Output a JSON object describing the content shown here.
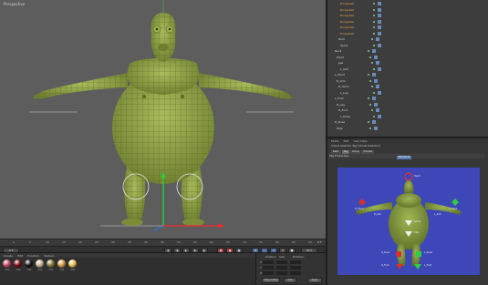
{
  "viewport": {
    "label": "Perspective",
    "header_icons": [
      "move-icon",
      "zoom-icon",
      "rotate-icon",
      "maximize-icon"
    ],
    "footer_text": "Grid Spacing: 100 cm"
  },
  "timeline": {
    "ticks": [
      "0",
      "5",
      "10",
      "15",
      "20",
      "25",
      "30",
      "35",
      "40",
      "45",
      "50",
      "55",
      "60",
      "65",
      "70",
      "75",
      "80",
      "85",
      "90"
    ],
    "current_frame": "0 F"
  },
  "transport": {
    "start_field": "0 F",
    "end_field": "90 F"
  },
  "materials": {
    "menu": [
      "Create",
      "Edit",
      "Function",
      "Texture"
    ],
    "items": [
      {
        "name": "Mat",
        "color": "#c84a6a"
      },
      {
        "name": "Mat",
        "color": "#7a1010"
      },
      {
        "name": "Mat",
        "color": "#1a1a1a"
      },
      {
        "name": "Mat",
        "color": "#c9b592"
      },
      {
        "name": "Mat",
        "color": "#8c7a3c"
      },
      {
        "name": "Mat",
        "color": "#d7a14a"
      },
      {
        "name": "Mat",
        "color": "#e8c25a"
      }
    ]
  },
  "coordinates": {
    "headers": [
      "Position",
      "Size",
      "Rotation"
    ],
    "rows": [
      {
        "axis": "X",
        "pos": "0 cm",
        "size": "0 cm",
        "rot": "H 0°"
      },
      {
        "axis": "Y",
        "pos": "0 cm",
        "size": "0 cm",
        "rot": "P 0°"
      },
      {
        "axis": "Z",
        "pos": "0 cm",
        "size": "0 cm",
        "rot": "B 0°"
      }
    ],
    "mode_select": "Object (Rel)",
    "size_select": "Size",
    "apply_button": "Apply"
  },
  "object_manager": {
    "menu": [
      "File",
      "Edit",
      "View",
      "Objects",
      "Tags",
      "Bookmarks"
    ],
    "rows": [
      {
        "name": "Bridgeball",
        "highlight": true
      },
      {
        "name": "Bridgeball",
        "highlight": true
      },
      {
        "name": "Bridgeball",
        "highlight": true
      },
      {
        "name": "Bridgeball",
        "highlight": true
      },
      {
        "name": "Bridgeball",
        "highlight": true
      },
      {
        "name": "Bridgeball",
        "highlight": true
      },
      {
        "name": "Root",
        "highlight": false
      },
      {
        "name": "Spine",
        "highlight": false
      },
      {
        "name": "Neck",
        "highlight": false
      },
      {
        "name": "Head",
        "highlight": false
      },
      {
        "name": "Jaw",
        "highlight": false
      },
      {
        "name": "L_Arm",
        "highlight": false
      },
      {
        "name": "L_Hand",
        "highlight": false
      },
      {
        "name": "R_Arm",
        "highlight": false
      },
      {
        "name": "R_Hand",
        "highlight": false
      },
      {
        "name": "L_Leg",
        "highlight": false
      },
      {
        "name": "L_Foot",
        "highlight": false
      },
      {
        "name": "R_Leg",
        "highlight": false
      },
      {
        "name": "R_Foot",
        "highlight": false
      },
      {
        "name": "L_Knee",
        "highlight": false
      },
      {
        "name": "R_Knee",
        "highlight": false
      },
      {
        "name": "Hips",
        "highlight": false
      }
    ]
  },
  "attribute_manager": {
    "menu": [
      "Mode",
      "Edit",
      "User Data"
    ],
    "title": "Visual Selector Tag [Visual Selector]",
    "tabs": [
      {
        "label": "Basic",
        "active": false
      },
      {
        "label": "Tag",
        "active": true
      },
      {
        "label": "Group",
        "active": false
      },
      {
        "label": "Preview",
        "active": false
      }
    ],
    "section": "Tag Properties",
    "ui_button": "Edit Mode"
  },
  "preview": {
    "labels": [
      "R_Hand",
      "L_Hand",
      "R_Arm",
      "L_Arm",
      "Head",
      "Spine",
      "Hips",
      "R_Knee",
      "L_Knee",
      "R_Foot",
      "L_Foot"
    ],
    "bg_color": "#3d47b8"
  },
  "colors": {
    "mesh_green": "#8ea04a",
    "axis_y": "#2ecc40",
    "axis_x": "#e03030",
    "ui_bg": "#2b2b2b",
    "viewport_bg": "#5d5d5d"
  }
}
